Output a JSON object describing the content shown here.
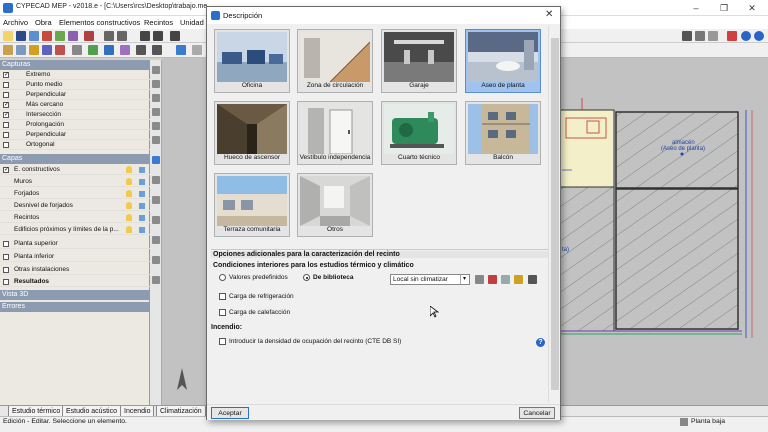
{
  "window": {
    "title": "CYPECAD MEP - v2018.e - [C:\\Users\\rcs\\Desktop\\trabajo.me",
    "minimize": "–",
    "maximize": "❐",
    "close": "✕"
  },
  "menu": {
    "items": [
      "Archivo",
      "Obra",
      "Elementos constructivos",
      "Recintos",
      "Unidad"
    ]
  },
  "left_panel": {
    "capturas_header": "Capturas",
    "capturas": [
      {
        "label": "Extremo",
        "checked": true
      },
      {
        "label": "Punto medio",
        "checked": false
      },
      {
        "label": "Perpendicular",
        "checked": false
      },
      {
        "label": "Más cercano",
        "checked": true
      },
      {
        "label": "Intersección",
        "checked": true
      },
      {
        "label": "Prolongación",
        "checked": false
      },
      {
        "label": "Perpendicular",
        "checked": false
      },
      {
        "label": "Ortogonal",
        "checked": false
      }
    ],
    "capas_header": "Capas",
    "capas": [
      {
        "label": "E. constructivos",
        "checked": true
      },
      {
        "label": "Muros"
      },
      {
        "label": "Forjados"
      },
      {
        "label": "Desnivel de forjados"
      },
      {
        "label": "Recintos"
      },
      {
        "label": "Edificios próximos y límites de la p..."
      }
    ],
    "plantas": [
      "Planta superior",
      "Planta inferior",
      "Otras instalaciones"
    ],
    "resultados": "Resultados",
    "vista3d": "Vista 3D",
    "errores": "Errores"
  },
  "canvas": {
    "room_label": "almacén",
    "room_sublabel": "(Aseo de planta)",
    "side_label": "ta)"
  },
  "bottom_tabs": [
    "Estudio térmico",
    "Estudio acústico",
    "Incendio",
    "Climatización"
  ],
  "status": {
    "text": "Edición - Editar.  Seleccione un elemento.",
    "floor": "Planta baja"
  },
  "dialog": {
    "title": "Descripción",
    "close": "✕",
    "thumbnails": [
      {
        "label": "Oficina",
        "selected": false
      },
      {
        "label": "Zona de circulación",
        "selected": false
      },
      {
        "label": "Garaje",
        "selected": false
      },
      {
        "label": "Aseo de planta",
        "selected": true
      },
      {
        "label": "Hueco de ascensor",
        "selected": false
      },
      {
        "label": "Vestíbulo independencia",
        "selected": false
      },
      {
        "label": "Cuarto técnico",
        "selected": false
      },
      {
        "label": "Balcón",
        "selected": false
      },
      {
        "label": "Terraza comunitaria",
        "selected": false
      },
      {
        "label": "Otros",
        "selected": false
      }
    ],
    "section_options": "Opciones adicionales para la caracterización del recinto",
    "section_conditions": "Condiciones interiores para los estudios térmico y climático",
    "radio_predefined": "Valores predefinidos",
    "radio_library": "De biblioteca",
    "radio_selected": "De biblioteca",
    "library_value": "Local sin climatizar",
    "check_cooling": "Carga de refrigeración",
    "check_heating": "Carga de calefacción",
    "section_fire": "Incendio:",
    "check_occupancy": "Introducir la densidad de ocupación del recinto (CTE DB SI)",
    "help": "?",
    "accept": "Aceptar",
    "cancel": "Cancelar"
  }
}
